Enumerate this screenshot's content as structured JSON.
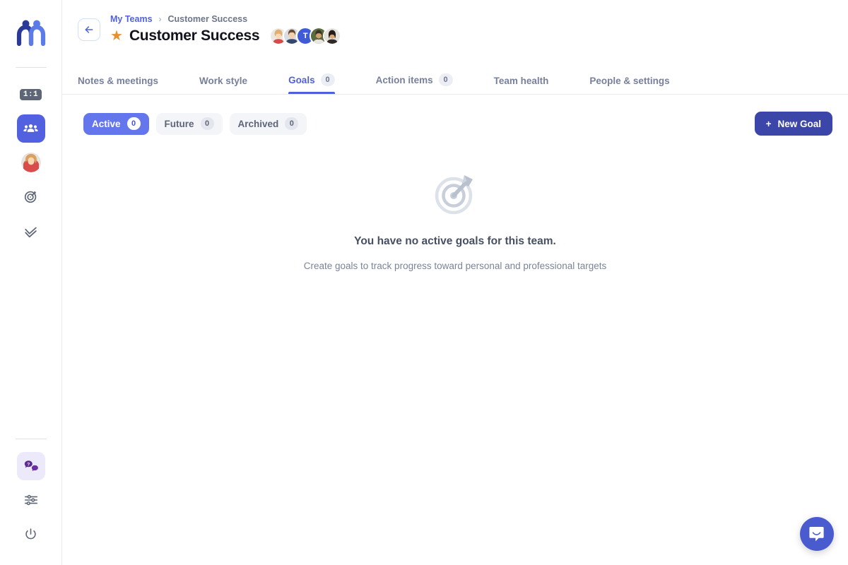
{
  "sidebar": {
    "logo": {
      "name": "mentorloop-logo",
      "colors": [
        "#2b3a97",
        "#5b7ce8"
      ]
    },
    "items": [
      {
        "name": "one-on-one",
        "label": "1:1",
        "type": "badge",
        "active": false
      },
      {
        "name": "teams",
        "label": "Teams",
        "type": "icon",
        "icon": "people-group-icon",
        "active": true
      },
      {
        "name": "profile",
        "label": "Profile",
        "type": "avatar",
        "icon": "user-avatar"
      },
      {
        "name": "goals",
        "label": "Goals",
        "type": "icon",
        "icon": "target-icon",
        "active": false
      },
      {
        "name": "action-items",
        "label": "Action items",
        "type": "icon",
        "icon": "double-check-icon",
        "active": false
      }
    ],
    "bottom_items": [
      {
        "name": "help",
        "label": "Help",
        "icon": "chat-question-icon",
        "active": true
      },
      {
        "name": "settings",
        "label": "Settings",
        "icon": "sliders-icon",
        "active": false
      },
      {
        "name": "logout",
        "label": "Log out",
        "icon": "power-icon",
        "active": false
      }
    ]
  },
  "header": {
    "back_button": {
      "icon": "arrow-left-icon",
      "label": "Back"
    },
    "breadcrumb": {
      "parent": "My Teams",
      "separator": "›",
      "current": "Customer Success"
    },
    "star_icon": "star-filled-icon",
    "title": "Customer Success",
    "members": [
      {
        "name": "member-1",
        "type": "photo",
        "initial": ""
      },
      {
        "name": "member-2",
        "type": "photo",
        "initial": ""
      },
      {
        "name": "member-3",
        "type": "initial",
        "initial": "T",
        "color": "#3f5bd8"
      },
      {
        "name": "member-4",
        "type": "photo",
        "initial": ""
      },
      {
        "name": "member-5",
        "type": "photo",
        "initial": ""
      }
    ]
  },
  "tabs": [
    {
      "name": "tab-notes-meetings",
      "label": "Notes & meetings",
      "badge": null,
      "active": false
    },
    {
      "name": "tab-work-style",
      "label": "Work style",
      "badge": null,
      "active": false
    },
    {
      "name": "tab-goals",
      "label": "Goals",
      "badge": "0",
      "active": true
    },
    {
      "name": "tab-action-items",
      "label": "Action items",
      "badge": "0",
      "active": false
    },
    {
      "name": "tab-team-health",
      "label": "Team health",
      "badge": null,
      "active": false
    },
    {
      "name": "tab-people-settings",
      "label": "People & settings",
      "badge": null,
      "active": false
    }
  ],
  "filters": [
    {
      "name": "filter-active",
      "label": "Active",
      "count": "0",
      "active": true
    },
    {
      "name": "filter-future",
      "label": "Future",
      "count": "0",
      "active": false
    },
    {
      "name": "filter-archived",
      "label": "Archived",
      "count": "0",
      "active": false
    }
  ],
  "actions": {
    "new_goal_plus": "+",
    "new_goal_label": "New Goal"
  },
  "empty_state": {
    "icon": "target-bullseye-icon",
    "title": "You have no active goals for this team.",
    "subtitle": "Create goals to track progress toward personal and professional targets"
  },
  "chat_widget": {
    "name": "intercom-launcher",
    "icon": "chat-bubble-icon"
  },
  "colors": {
    "primary": "#5161e0",
    "primary_dark": "#3b46a8",
    "pill_active": "#6476ec",
    "star": "#e8902e",
    "text_muted": "#77809a"
  }
}
